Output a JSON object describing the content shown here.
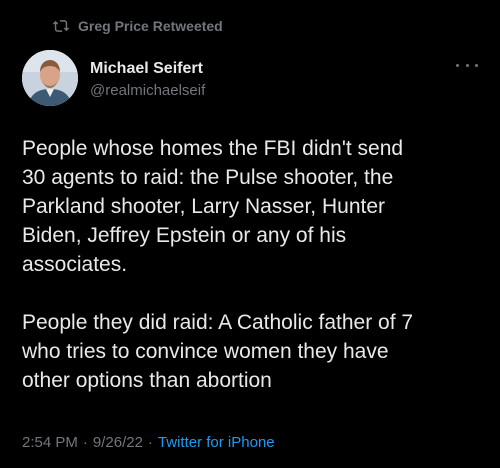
{
  "retweet": {
    "icon": "retweet-icon",
    "label": "Greg Price Retweeted"
  },
  "author": {
    "name": "Michael Seifert",
    "handle": "@realmichaelseif",
    "avatar_icon": "avatar"
  },
  "more_icon": "more-horizontal-icon",
  "tweet": {
    "paragraphs": [
      "People whose homes the FBI didn't send\n30 agents to raid: the Pulse shooter, the\nParkland shooter, Larry Nasser, Hunter\nBiden, Jeffrey Epstein or any of his\nassociates.",
      "People they did raid: A Catholic father of 7\nwho tries to convince women they have\nother options than abortion"
    ]
  },
  "meta": {
    "time": "2:54 PM",
    "separator1": "·",
    "date": "9/26/22",
    "separator2": "·",
    "source": "Twitter for iPhone"
  },
  "colors": {
    "background": "#000000",
    "text": "#e7e9ea",
    "secondary": "#71767b",
    "link": "#1d9bf0"
  }
}
